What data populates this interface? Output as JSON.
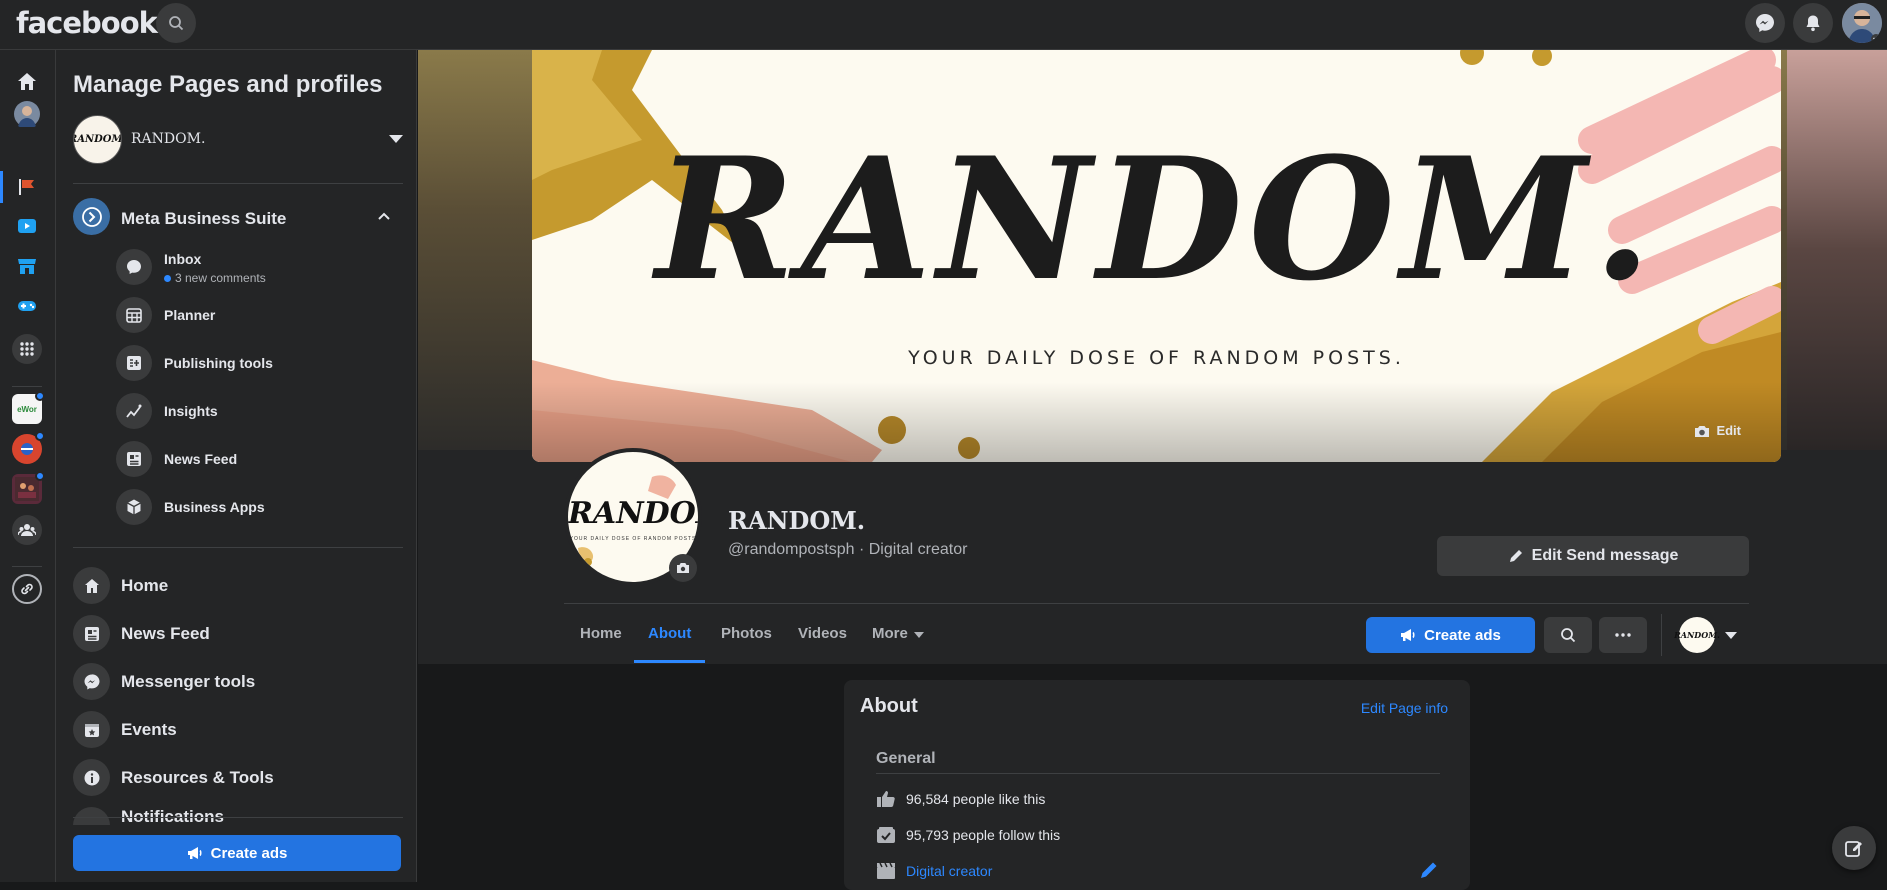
{
  "topbar": {
    "logo": "facebook"
  },
  "sidebar": {
    "title": "Manage Pages and profiles",
    "page_selector": {
      "name": "RANDOM.",
      "avatar_text": "RANDOM."
    },
    "meta_business_suite": {
      "label": "Meta Business Suite"
    },
    "sub_items": [
      {
        "label": "Inbox",
        "meta": "3 new comments",
        "icon": "chat-bubble-icon"
      },
      {
        "label": "Planner",
        "icon": "calendar-grid-icon"
      },
      {
        "label": "Publishing tools",
        "icon": "publishing-tools-icon"
      },
      {
        "label": "Insights",
        "icon": "insights-icon"
      },
      {
        "label": "News Feed",
        "icon": "news-feed-icon"
      },
      {
        "label": "Business Apps",
        "icon": "box-icon"
      }
    ],
    "nav_items": [
      {
        "label": "Home",
        "icon": "home-icon"
      },
      {
        "label": "News Feed",
        "icon": "news-feed-icon"
      },
      {
        "label": "Messenger tools",
        "icon": "messenger-icon"
      },
      {
        "label": "Events",
        "icon": "calendar-star-icon"
      },
      {
        "label": "Resources & Tools",
        "icon": "info-icon"
      },
      {
        "label": "Notifications",
        "icon": "bell-icon"
      }
    ],
    "create_ads": "Create ads"
  },
  "page": {
    "cover_title": "RANDOM.",
    "cover_tagline": "YOUR DAILY DOSE OF RANDOM POSTS.",
    "cover_edit": "Edit",
    "avatar_title": "RANDOM.",
    "avatar_sub": "YOUR DAILY DOSE OF RANDOM POSTS",
    "name": "RANDOM.",
    "subtitle": "@randompostsph · Digital creator",
    "edit_send_button": "Edit Send message",
    "tabs": [
      "Home",
      "About",
      "Photos",
      "Videos",
      "More"
    ],
    "active_tab": "About",
    "create_ads": "Create ads",
    "small_avatar_text": "RANDOM."
  },
  "about": {
    "title": "About",
    "edit_link": "Edit Page info",
    "general_title": "General",
    "likes": "96,584 people like this",
    "follows": "95,793 people follow this",
    "category": "Digital creator"
  },
  "colors": {
    "accent": "#2d88ff",
    "button_blue": "#2374e1",
    "surface": "#242526",
    "background": "#18191a"
  }
}
